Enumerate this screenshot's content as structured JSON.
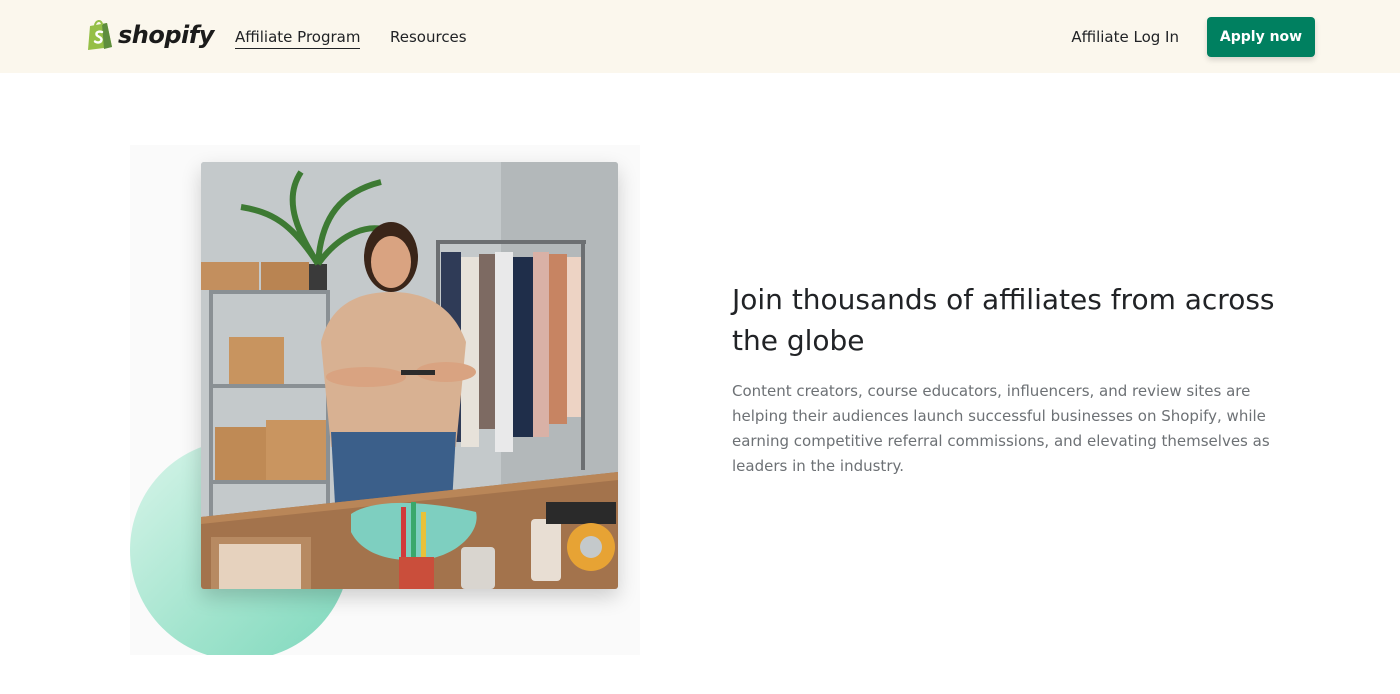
{
  "header": {
    "logo_text": "shopify",
    "nav": [
      {
        "label": "Affiliate Program",
        "active": true
      },
      {
        "label": "Resources",
        "active": false
      }
    ],
    "login_label": "Affiliate Log In",
    "apply_label": "Apply now"
  },
  "hero": {
    "headline": "Join thousands of affiliates from across the globe",
    "body": "Content creators, course educators, influencers, and review sites are helping their audiences launch successful businesses on Shopify, while earning competitive referral commissions, and elevating themselves as leaders in the industry."
  },
  "colors": {
    "header_bg": "#fbf7ed",
    "brand_green": "#008060",
    "logo_green": "#95bf47",
    "accent_mint": "#9fe3cc"
  },
  "icons": [
    "shopify-bag-icon"
  ]
}
